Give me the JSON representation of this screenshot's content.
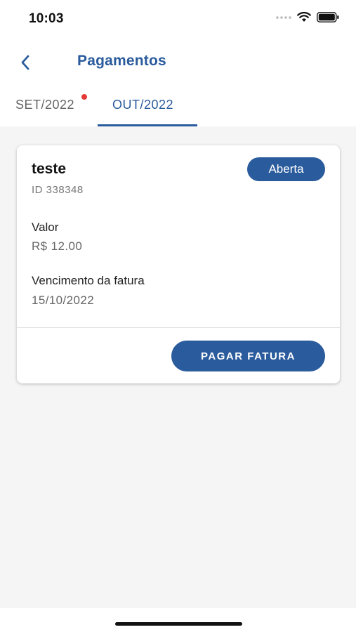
{
  "status_bar": {
    "time": "10:03",
    "icons": [
      "signal-dots-icon",
      "wifi-icon",
      "battery-icon"
    ]
  },
  "header": {
    "back_icon": "chevron-left-icon",
    "title": "Pagamentos"
  },
  "tabs": [
    {
      "label": "SET/2022",
      "active": false,
      "has_notification": true
    },
    {
      "label": "OUT/2022",
      "active": true,
      "has_notification": false
    }
  ],
  "invoice": {
    "title": "teste",
    "status": "Aberta",
    "id_label": "ID 338348",
    "amount_label": "Valor",
    "amount_value": "R$ 12.00",
    "due_label": "Vencimento da fatura",
    "due_value": "15/10/2022",
    "pay_button": "PAGAR FATURA"
  },
  "colors": {
    "primary": "#2a5b9c",
    "notification": "#e53935",
    "background": "#f5f5f5"
  }
}
